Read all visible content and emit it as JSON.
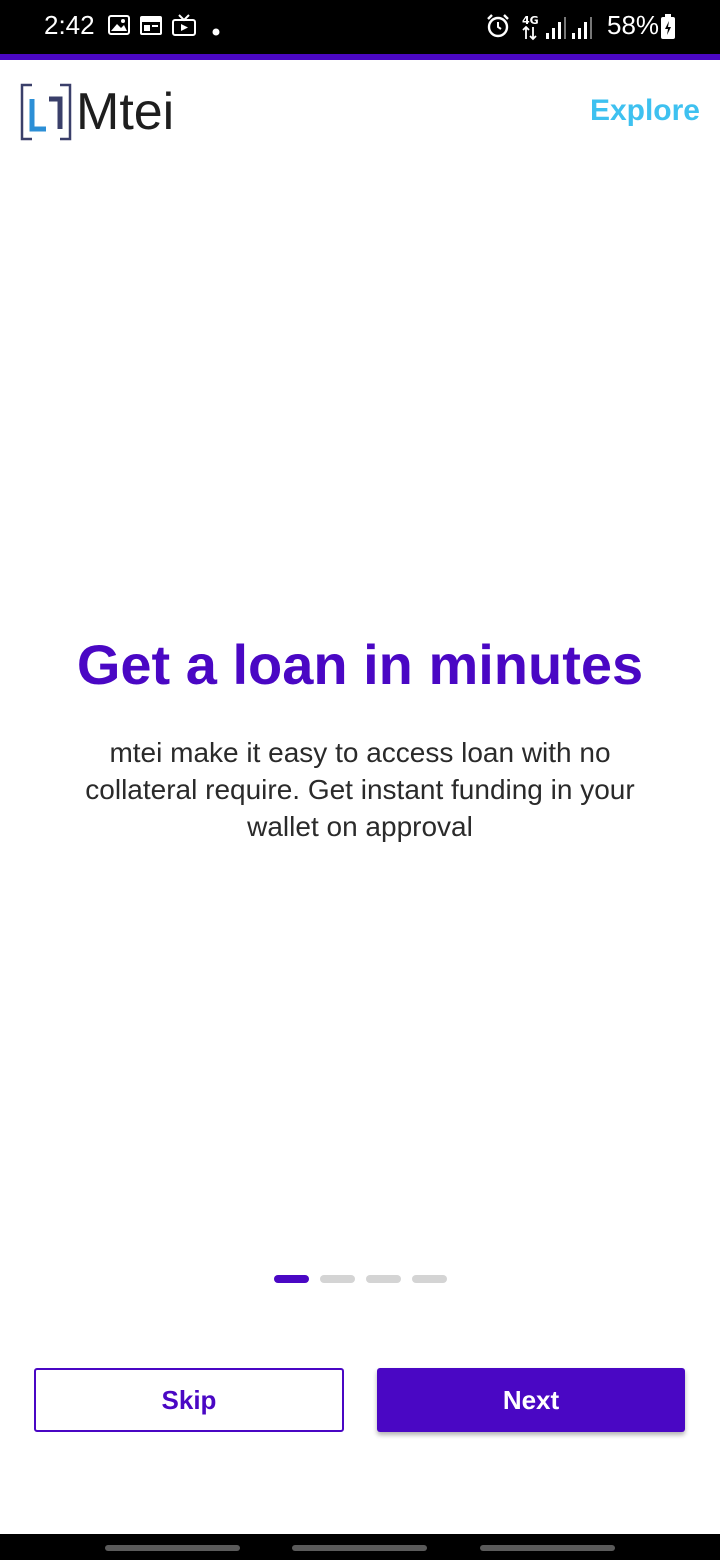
{
  "status_bar": {
    "time": "2:42",
    "left_icons": [
      "image-icon",
      "calendar-icon",
      "tv-icon",
      "dot-icon"
    ],
    "right_icons": [
      "alarm-icon",
      "network-4g-icon",
      "signal-icon",
      "signal-icon",
      "battery-icon"
    ],
    "network": "4G",
    "battery": "58%"
  },
  "header": {
    "logo_text": "Mtei",
    "explore_label": "Explore"
  },
  "onboarding": {
    "title": "Get a loan in minutes",
    "description": "mtei make it easy to access loan with no collateral require. Get instant funding in your wallet on approval",
    "page_count": 4,
    "current_page": 1
  },
  "actions": {
    "skip_label": "Skip",
    "next_label": "Next"
  },
  "colors": {
    "primary": "#4a07c4",
    "explore": "#3ec1f0",
    "dot_inactive": "#d4d4d4"
  }
}
